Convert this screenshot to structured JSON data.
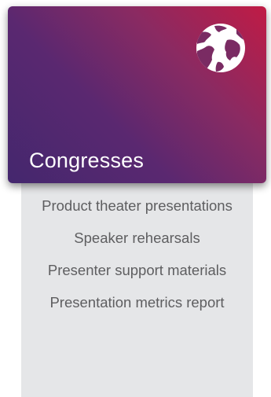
{
  "card": {
    "title": "Congresses",
    "icon": "globe-icon",
    "gradient_colors": [
      "#c01b45",
      "#8a2a62",
      "#5a2870",
      "#44276e"
    ],
    "body_background": "#e5e6e8",
    "items": [
      {
        "label": "Product theater presentations"
      },
      {
        "label": "Speaker rehearsals"
      },
      {
        "label": "Presenter support materials"
      },
      {
        "label": "Presentation metrics report"
      }
    ]
  }
}
